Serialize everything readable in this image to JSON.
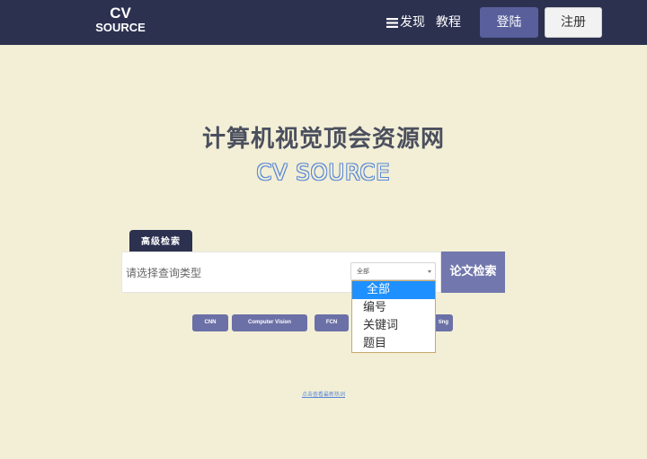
{
  "header": {
    "logo_line1": "CV",
    "logo_line2": "SOURCE",
    "discover_label": "发现",
    "tutorial_label": "教程",
    "login_label": "登陆",
    "register_label": "注册"
  },
  "hero": {
    "title": "计算机视觉顶会资源网",
    "subtitle": "CV SOURCE"
  },
  "search": {
    "advanced_tab": "高级检索",
    "placeholder": "请选择查询类型",
    "select_value": "全部",
    "button_label": "论文检索"
  },
  "dropdown": {
    "options": [
      "全部",
      "编号",
      "关键词",
      "题目"
    ],
    "highlighted": "全部"
  },
  "tags": [
    "CNN",
    "Computer Vision",
    "FCN",
    "ting"
  ],
  "hot_link": "点击查看最新热词",
  "colors": {
    "nav_bg": "#2c3150",
    "page_bg": "#f2efd6",
    "accent": "#585f9b",
    "tag_bg": "#6b70a6",
    "dropdown_highlight": "#1e90ff"
  }
}
